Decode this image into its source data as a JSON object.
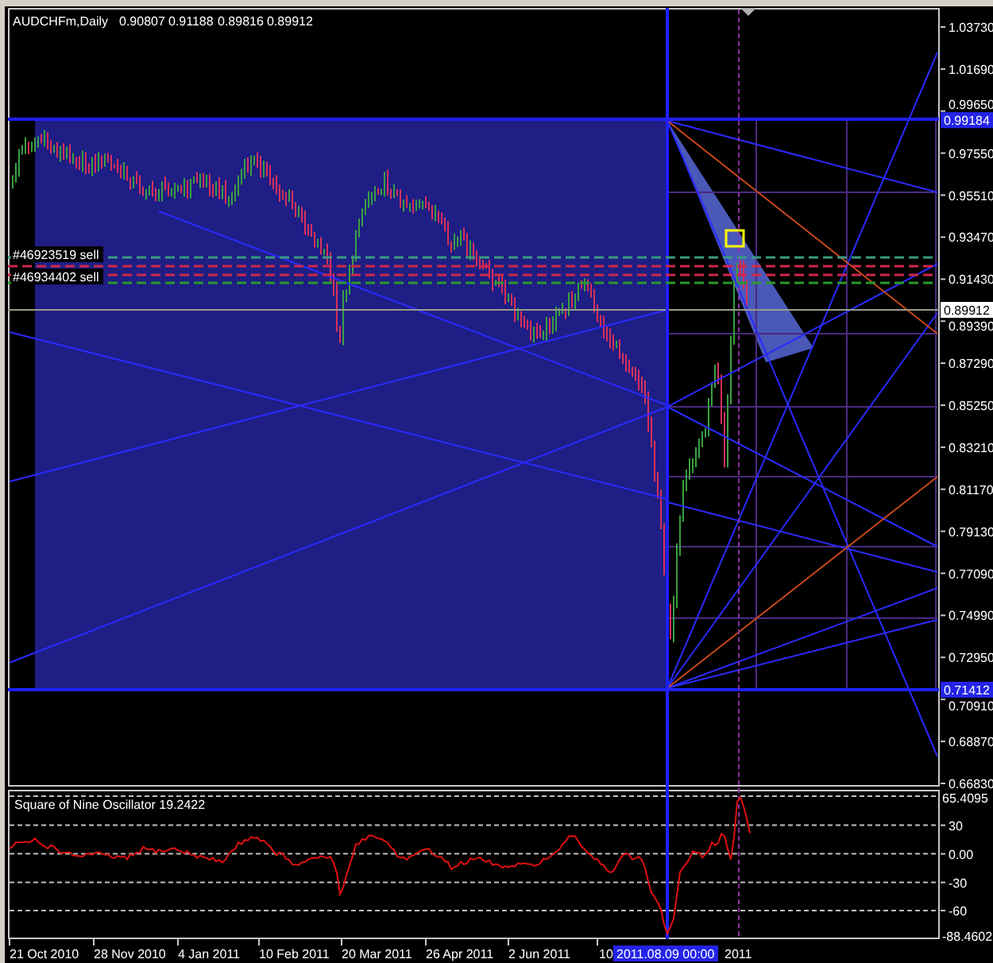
{
  "chart": {
    "symbol": "AUDCHFm,Daily",
    "ohlc": [
      "0.90807",
      "0.91188",
      "0.89816",
      "0.89912"
    ],
    "price_scale": [
      "1.03730",
      "1.01690",
      "0.99650",
      "0.97550",
      "0.95510",
      "0.93470",
      "0.91430",
      "0.89390",
      "0.87290",
      "0.85250",
      "0.83210",
      "0.81170",
      "0.79130",
      "0.77090",
      "0.74990",
      "0.72950",
      "0.70910",
      "0.68870",
      "0.66830"
    ],
    "price_tags": [
      {
        "kind": "line",
        "text": "0.99184"
      },
      {
        "kind": "bid",
        "text": "0.89912"
      },
      {
        "kind": "line",
        "text": "0.71412"
      }
    ],
    "orders": [
      {
        "label": "#46923519 sell"
      },
      {
        "label": "#46934402 sell"
      }
    ]
  },
  "indicator": {
    "title": "Square of Nine Oscillator 19.2422",
    "scale": [
      "30",
      "0.00",
      "-30",
      "-60"
    ],
    "value_tags": [
      "65.4095",
      "-88.4602"
    ]
  },
  "time_axis": {
    "labels": [
      "21 Oct 2010",
      "28 Nov 2010",
      "4 Jan 2011",
      "10 Feb 2011",
      "20 Mar 2011",
      "26 Apr 2011",
      "2 Jun 2011",
      "10",
      "2011"
    ],
    "cursor_label": "2011.08.09 00:00"
  }
}
